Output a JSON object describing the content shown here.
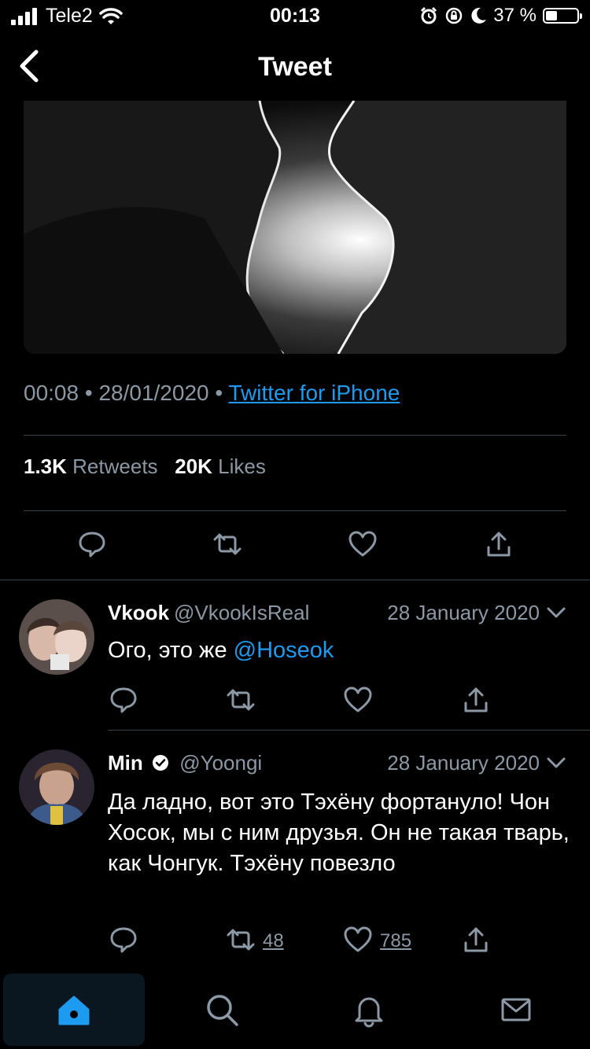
{
  "status_bar": {
    "carrier": "Tele2",
    "time": "00:13",
    "battery": "37 %",
    "battery_level": 0.37
  },
  "nav": {
    "title": "Tweet",
    "back_icon": "chevron-left-icon"
  },
  "tweet": {
    "time": "00:08",
    "separator": "•",
    "date": "28/01/2020",
    "source": "Twitter for iPhone",
    "retweets_count": "1.3K",
    "retweets_label": "Retweets",
    "likes_count": "20K",
    "likes_label": "Likes"
  },
  "replies": [
    {
      "name": "Vkook",
      "handle": "@VkookIsReal",
      "date": "28 January 2020",
      "text_before": "Ого, это же ",
      "mention": "@Hoseok",
      "retweets": "",
      "likes": ""
    },
    {
      "name": "Min",
      "verified": true,
      "handle": "@Yoongi",
      "date": "28 January 2020",
      "text": "Да ладно, вот это Тэхёну фортануло! Чон Хосок, мы с ним друзья. Он не такая тварь, как Чонгук. Тэхёну повезло",
      "retweets": "48",
      "likes": "785"
    }
  ],
  "tabs": [
    "home-icon",
    "search-icon",
    "notifications-icon",
    "messages-icon"
  ],
  "colors": {
    "accent": "#1d9bf0",
    "muted": "#8b98a5",
    "divider": "#38444d",
    "background": "#000000"
  }
}
